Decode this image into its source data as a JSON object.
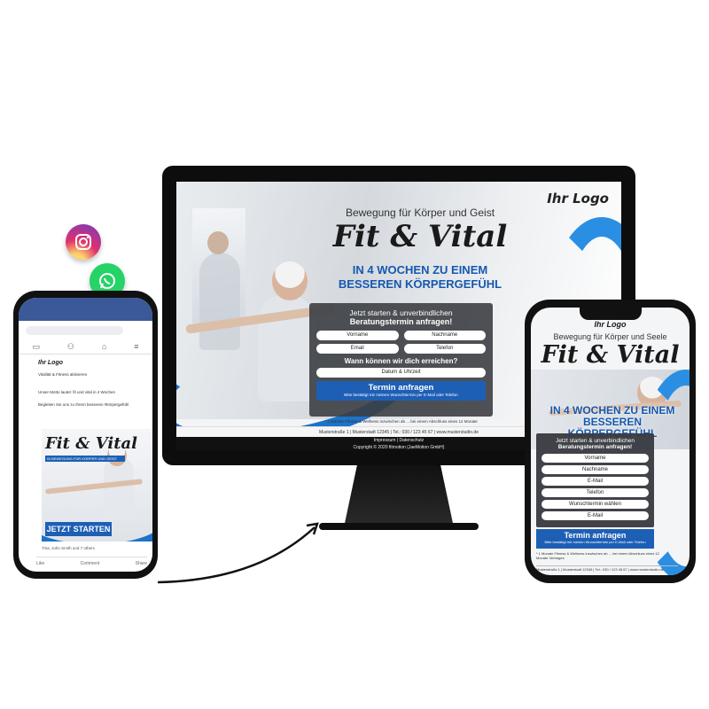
{
  "social_icons": [
    {
      "name": "instagram-icon",
      "glyph": "",
      "color": "#e1306c"
    },
    {
      "name": "whatsapp-icon",
      "glyph": "",
      "color": "#25d366"
    },
    {
      "name": "facebook-icon",
      "glyph": "f",
      "color": "#1877f2"
    }
  ],
  "colors": {
    "brand_blue": "#1d5fb5",
    "claim_blue": "#1558b0",
    "form_bg": "#3c3e44"
  },
  "desktop": {
    "logo": "Ihr Logo",
    "subtitle": "Bewegung für Körper und Geist",
    "title": "Fit & Vital",
    "claim_line1": "IN 4 WOCHEN ZU EINEM",
    "claim_line2": "BESSEREN KÖRPERGEFÜHL",
    "form": {
      "heading1": "Jetzt starten & unverbindlichen",
      "heading2": "Beratungstermin anfragen!",
      "first_name": "Vorname",
      "last_name": "Nachname",
      "email": "Email",
      "phone": "Telefon",
      "question": "Wann können wir dich erreichen?",
      "datetime": "Datum & Uhrzeit",
      "cta": "Termin anfragen",
      "cta_note": "Bitte bestätigt mir meinen Wunschtermin per E-Mail oder Telefon"
    },
    "fine_print": "* 1 Monate Fitness & Wellness inzwischen ab ... bei einem Abschluss eines 12 Monate",
    "footer_address": "Musterstraße 1 | Musterstadt 12345 | Tel.: 030 / 123 45 67 | www.musterstudio.de",
    "footer_links": "Impressum | Datenschutz",
    "footer_copyright": "Copyright © 2020 fitmotion (JaeMotion GmbH)"
  },
  "facebook_phone": {
    "page_name": "Ihr Logo",
    "post_line1": "Vitalität & Fitness aktivieren",
    "post_line2": "Unser Motto lautet: fit und vital in 4 Wochen",
    "post_line3": "Begleiten Sie uns zu Ihrem besseren #körpergefühl",
    "ad_title": "Fit & Vital",
    "ad_claim": "IN BEWEGUNG FÜR KÖRPER UND GEIST",
    "ad_cta": "JETZT STARTEN",
    "reactions": "Tina, John Smith und 7 others",
    "action_like": "Like",
    "action_comment": "Comment",
    "action_share": "Share"
  },
  "mobile": {
    "logo": "Ihr Logo",
    "subtitle": "Bewegung für Körper und Seele",
    "title": "Fit & Vital",
    "claim_line1": "IN 4 WOCHEN ZU EINEM",
    "claim_line2": "BESSEREN KÖRPERGEFÜHL",
    "form": {
      "heading1": "Jetzt starten & unverbindlichen",
      "heading2": "Beratungstermin anfragen!",
      "first_name": "Vorname",
      "last_name": "Nachname",
      "email": "E-Mail",
      "phone": "Telefon",
      "appointment": "Wunschtermin wählen",
      "email2": "E-Mail"
    },
    "cta": "Termin anfragen",
    "cta_note": "Bitte bestätigt mir meinen Wunschtermin per E-Mail oder Telefon",
    "fine_print": "* 1 Monate Fitness & Wellness inzwischen ab ... bei einem Abschluss eines 12 Monate Vertrages",
    "footer": "Musterstraße 1 | Musterstadt 12345 | Tel.: 030 / 123 45 67 | www.musterstudio.de"
  }
}
